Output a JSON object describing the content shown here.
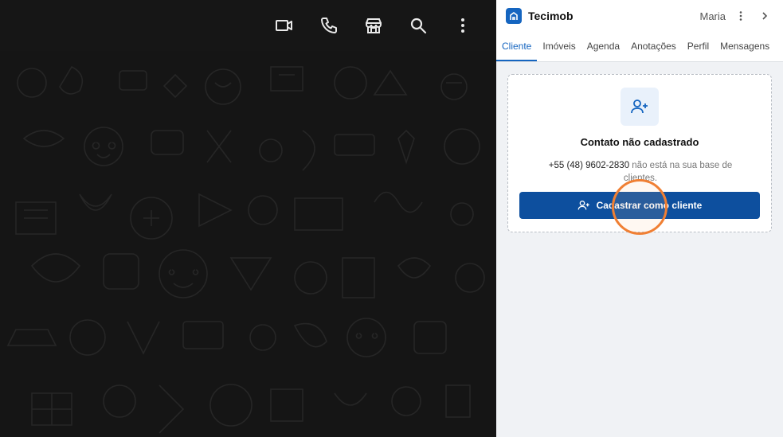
{
  "chat_header": {
    "icons": [
      "video-call-icon",
      "voice-call-icon",
      "catalog-icon",
      "search-icon",
      "more-options-icon"
    ]
  },
  "panel": {
    "brand": "Tecimob",
    "user": "Maria",
    "tabs": [
      {
        "label": "Cliente",
        "active": true
      },
      {
        "label": "Imóveis",
        "active": false
      },
      {
        "label": "Agenda",
        "active": false
      },
      {
        "label": "Anotações",
        "active": false
      },
      {
        "label": "Perfil",
        "active": false
      },
      {
        "label": "Mensagens",
        "active": false
      }
    ],
    "card": {
      "title": "Contato não cadastrado",
      "phone": "+55 (48) 9602-2830",
      "description": " não está na sua base de clientes.",
      "button_label": "Cadastrar como cliente"
    }
  },
  "colors": {
    "accent": "#1565c0",
    "button": "#0d4f9e",
    "click_highlight": "#f07f33"
  }
}
